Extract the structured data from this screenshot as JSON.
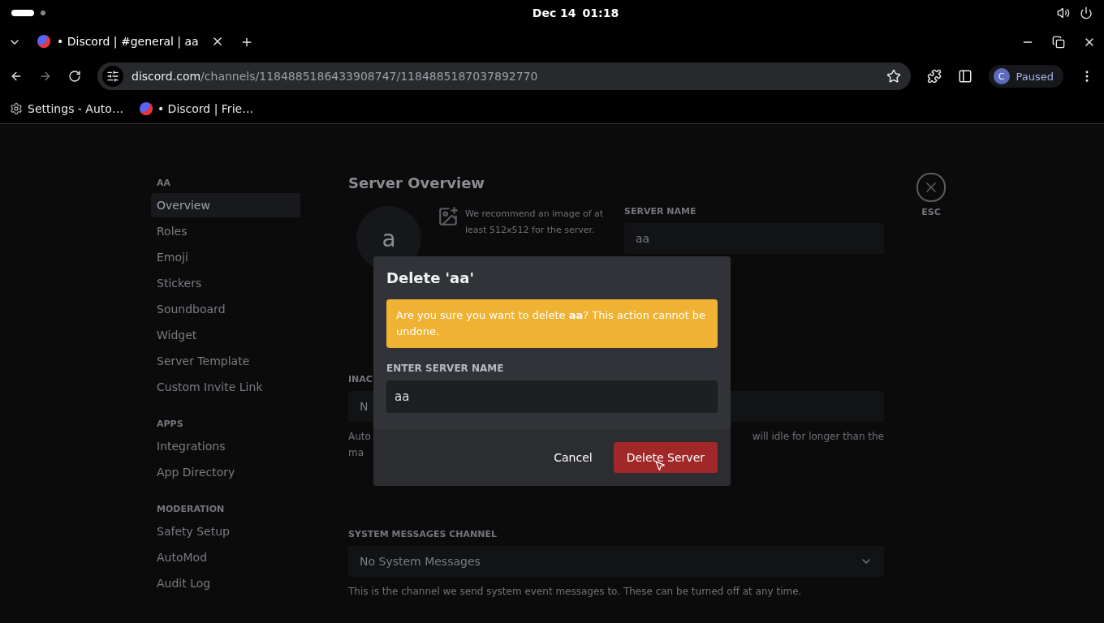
{
  "system_bar": {
    "date": "Dec 14",
    "time": "01:18"
  },
  "browser": {
    "tabs": [
      {
        "title": "• Discord | #general | aa",
        "selected": true
      }
    ],
    "url": {
      "host": "discord.com",
      "path": "/channels/1184885186433908747/1184885187037892770"
    },
    "profile": {
      "initial": "C",
      "status": "Paused"
    },
    "bookmarks": [
      {
        "kind": "settings",
        "label": "Settings - Auto…"
      },
      {
        "kind": "discord",
        "label": "• Discord | Frie…"
      }
    ]
  },
  "settings": {
    "sidebar": [
      {
        "heading": "AA",
        "items": [
          {
            "label": "Overview",
            "selected": true
          },
          {
            "label": "Roles",
            "selected": false
          },
          {
            "label": "Emoji",
            "selected": false
          },
          {
            "label": "Stickers",
            "selected": false
          },
          {
            "label": "Soundboard",
            "selected": false
          },
          {
            "label": "Widget",
            "selected": false
          },
          {
            "label": "Server Template",
            "selected": false
          },
          {
            "label": "Custom Invite Link",
            "selected": false
          }
        ]
      },
      {
        "heading": "APPS",
        "items": [
          {
            "label": "Integrations",
            "selected": false
          },
          {
            "label": "App Directory",
            "selected": false
          }
        ]
      },
      {
        "heading": "MODERATION",
        "items": [
          {
            "label": "Safety Setup",
            "selected": false
          },
          {
            "label": "AutoMod",
            "selected": false
          },
          {
            "label": "Audit Log",
            "selected": false
          }
        ]
      }
    ],
    "title": "Server Overview",
    "server_icon_letter": "a",
    "upload_hint": "We recommend an image of at least 512x512 for the server.",
    "server_name": {
      "label": "SERVER NAME",
      "value": "aa"
    },
    "inactive": {
      "label": "INAC",
      "value": "N",
      "help_start": "Auto",
      "help_start_2": "ma",
      "help_end": "will idle for longer than the"
    },
    "system_channel": {
      "label": "SYSTEM MESSAGES CHANNEL",
      "value": "No System Messages",
      "help": "This is the channel we send system event messages to. These can be turned off at any time."
    },
    "close_label": "ESC"
  },
  "dialog": {
    "title": "Delete 'aa'",
    "warning": "Are you sure you want to delete **aa**? This action cannot be undone.",
    "field_label": "ENTER SERVER NAME",
    "field_value": "aa",
    "buttons": [
      {
        "kind": "secondary",
        "label": "Cancel"
      },
      {
        "kind": "danger",
        "label": "Delete Server"
      }
    ]
  }
}
